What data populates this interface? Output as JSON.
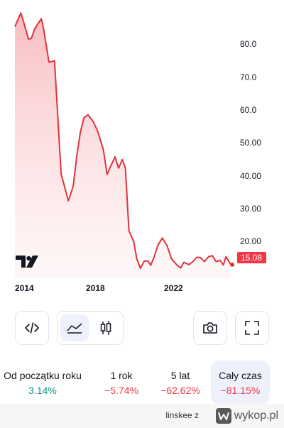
{
  "chart_data": {
    "type": "area",
    "x": [
      2013.65,
      2013.92,
      2014.05,
      2014.27,
      2014.4,
      2014.55,
      2014.85,
      2014.95,
      2015.2,
      2015.45,
      2015.75,
      2016.08,
      2016.3,
      2016.45,
      2016.62,
      2016.78,
      2016.97,
      2017.2,
      2017.4,
      2017.67,
      2017.84,
      2017.97,
      2018.2,
      2018.36,
      2018.53,
      2018.67,
      2018.83,
      2019.05,
      2019.19,
      2019.35,
      2019.52,
      2019.68,
      2019.82,
      2019.97,
      2020.15,
      2020.35,
      2020.56,
      2020.77,
      2021.02,
      2021.18,
      2021.33,
      2021.55,
      2021.72,
      2021.92,
      2022.08,
      2022.26,
      2022.45,
      2022.62,
      2022.79,
      2022.97,
      2023.12,
      2023.24,
      2023.46
    ],
    "values": [
      86.7,
      90.8,
      88.0,
      82.9,
      83.2,
      86.1,
      89.1,
      86.1,
      76.0,
      76.4,
      42.4,
      34.3,
      38.7,
      47.2,
      54.8,
      59.2,
      60.2,
      58.2,
      55.4,
      49.6,
      42.2,
      44.3,
      47.5,
      44.1,
      46.7,
      44.1,
      25.3,
      22.0,
      16.8,
      14.0,
      16.1,
      16.3,
      14.9,
      17.3,
      21.0,
      23.1,
      20.8,
      16.8,
      14.9,
      14.1,
      15.8,
      15.1,
      15.9,
      17.3,
      17.2,
      16.0,
      17.5,
      17.8,
      16.0,
      16.4,
      15.0,
      17.5,
      15.08
    ],
    "xlim": [
      2013.65,
      2023.65
    ],
    "ylim": [
      11.0,
      93.0
    ],
    "yticks": [
      "80.0",
      "70.0",
      "60.0",
      "50.00",
      "40.00",
      "30.00",
      "20.00"
    ],
    "xticks": [
      "2014",
      "2018",
      "2022"
    ],
    "last_price": "15.08",
    "colors": {
      "line": "#e0323c",
      "fill": "#fbd2d3",
      "badge": "#f23645"
    }
  },
  "toolbar": {
    "embed": "code-icon",
    "area_chart": "area-chart-icon",
    "candles": "candlestick-icon",
    "snapshot": "camera-icon",
    "fullscreen": "fullscreen-icon"
  },
  "ranges": [
    {
      "label": "Od początku roku",
      "value": "3.14%",
      "trend": "positive"
    },
    {
      "label": "1 rok",
      "value": "−5.74%",
      "trend": "negative"
    },
    {
      "label": "5 lat",
      "value": "−62.62%",
      "trend": "negative"
    },
    {
      "label": "Cały czas",
      "value": "−81.15%",
      "trend": "negative"
    }
  ],
  "footer": {
    "user": "linskee z",
    "brand": "wykop.pl"
  }
}
